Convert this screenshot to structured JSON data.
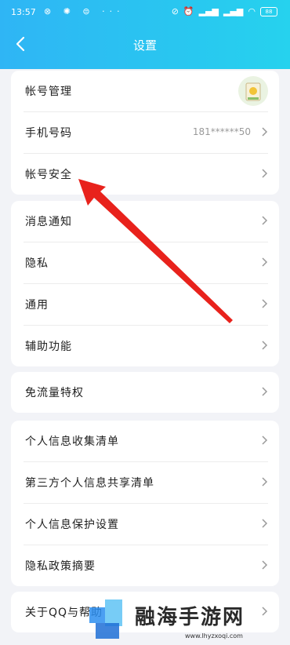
{
  "status_bar": {
    "time": "13:57",
    "left_icons": "⊗ ✺ ⊜ ···",
    "battery": "88"
  },
  "header": {
    "title": "设置"
  },
  "groups": [
    {
      "rows": [
        {
          "label": "帐号管理",
          "value": "",
          "has_avatar": true
        },
        {
          "label": "手机号码",
          "value": "181******50",
          "has_avatar": false
        },
        {
          "label": "帐号安全",
          "value": "",
          "has_avatar": false
        }
      ]
    },
    {
      "rows": [
        {
          "label": "消息通知",
          "value": ""
        },
        {
          "label": "隐私",
          "value": ""
        },
        {
          "label": "通用",
          "value": ""
        },
        {
          "label": "辅助功能",
          "value": ""
        }
      ]
    },
    {
      "rows": [
        {
          "label": "免流量特权",
          "value": ""
        }
      ]
    },
    {
      "rows": [
        {
          "label": "个人信息收集清单",
          "value": ""
        },
        {
          "label": "第三方个人信息共享清单",
          "value": ""
        },
        {
          "label": "个人信息保护设置",
          "value": ""
        },
        {
          "label": "隐私政策摘要",
          "value": ""
        }
      ]
    },
    {
      "rows": [
        {
          "label": "关于QQ与帮助",
          "value": ""
        }
      ]
    }
  ],
  "annotation": {
    "color": "#e8221c"
  },
  "watermark": {
    "text": "融海手游网",
    "url": "www.lhyzxoqi.com"
  }
}
